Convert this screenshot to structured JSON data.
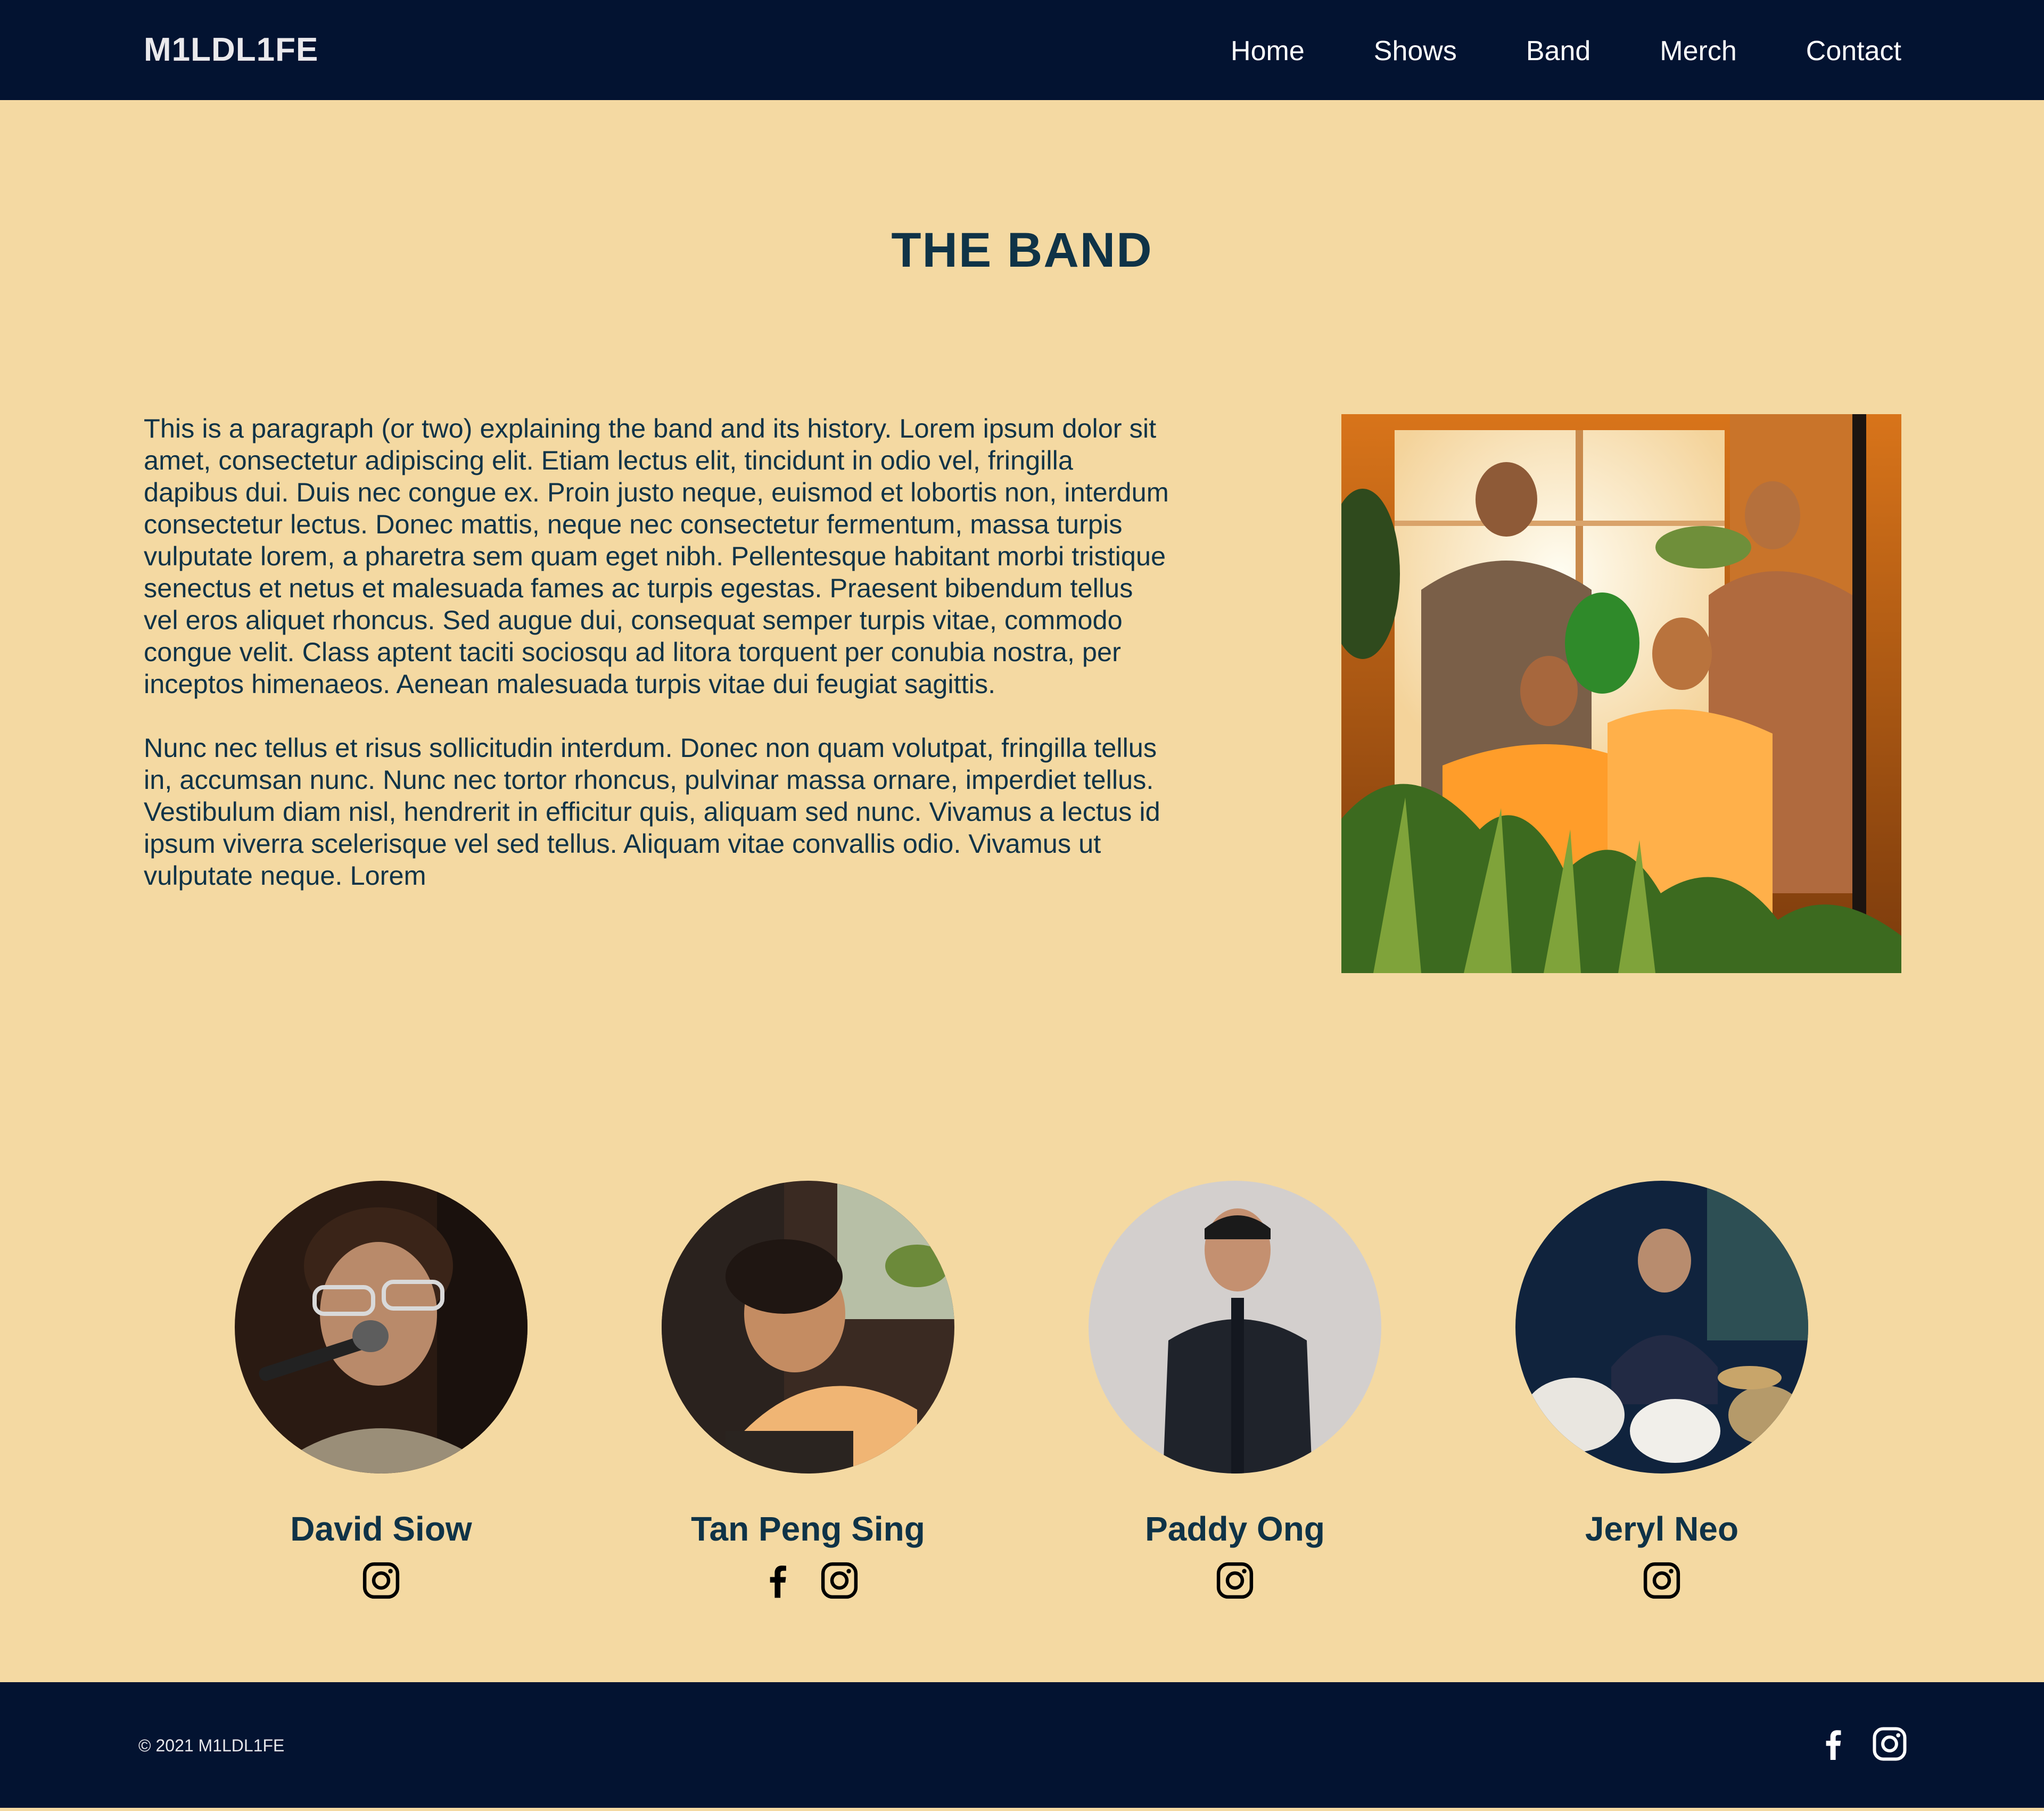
{
  "header": {
    "logo": "M1LDL1FE",
    "nav": [
      {
        "label": "Home"
      },
      {
        "label": "Shows"
      },
      {
        "label": "Band"
      },
      {
        "label": "Merch"
      },
      {
        "label": "Contact"
      }
    ]
  },
  "main": {
    "title": "THE BAND",
    "paragraphs": [
      "This is a paragraph (or two) explaining the band and its history. Lorem ipsum dolor sit amet, consectetur adipiscing elit. Etiam lectus elit, tincidunt in odio vel, fringilla dapibus dui. Duis nec congue ex. Proin justo neque, euismod et lobortis non, interdum consectetur lectus. Donec mattis, neque nec consectetur fermentum, massa turpis vulputate lorem, a pharetra sem quam eget nibh. Pellentesque habitant morbi tristique senectus et netus et malesuada fames ac turpis egestas. Praesent bibendum tellus vel eros aliquet rhoncus. Sed augue dui, consequat semper turpis vitae, commodo congue velit. Class aptent taciti sociosqu ad litora torquent per conubia nostra, per inceptos himenaeos. Aenean malesuada turpis vitae dui feugiat sagittis.",
      "Nunc nec tellus et risus sollicitudin interdum. Donec non quam volutpat, fringilla tellus in, accumsan nunc. Nunc nec tortor rhoncus, pulvinar massa ornare, imperdiet tellus. Vestibulum diam nisl, hendrerit in efficitur quis, aliquam sed nunc. Vivamus a lectus id ipsum viverra scelerisque vel sed tellus. Aliquam vitae convallis odio. Vivamus ut vulputate neque. Lorem"
    ]
  },
  "members": [
    {
      "name": "David Siow",
      "socials": [
        "instagram-icon"
      ]
    },
    {
      "name": "Tan Peng Sing",
      "socials": [
        "facebook-icon",
        "instagram-icon"
      ]
    },
    {
      "name": "Paddy Ong",
      "socials": [
        "instagram-icon"
      ]
    },
    {
      "name": "Jeryl Neo",
      "socials": [
        "instagram-icon"
      ]
    }
  ],
  "footer": {
    "copyright": "© 2021 M1LDL1FE",
    "socials": [
      "facebook-icon",
      "instagram-icon"
    ]
  },
  "colors": {
    "background": "#f4d9a2",
    "header_footer": "#031331",
    "heading_text": "#0f3347"
  }
}
